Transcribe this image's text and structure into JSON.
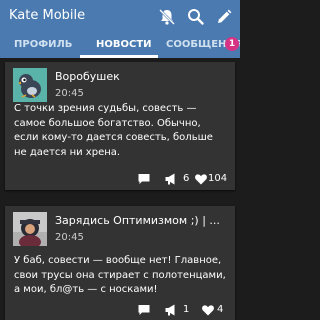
{
  "app": {
    "title": "Kate Mobile"
  },
  "actionbar": {
    "icons": [
      "notifications-off-icon",
      "search-icon",
      "edit-icon"
    ]
  },
  "tabs": [
    {
      "label": "ПРОФИЛЬ",
      "active": false
    },
    {
      "label": "НОВОСТИ",
      "active": true
    },
    {
      "label": "СООБЩЕНИЯ",
      "active": false
    }
  ],
  "messages_badge": "1",
  "posts": [
    {
      "author": "Воробушек",
      "time": "20:45",
      "text": "С точки зрения судьбы, совесть — самое большое богатство. Обычно, если кому-то дается совесть, больше не дается ни хрена.",
      "reposts": "6",
      "likes": "104"
    },
    {
      "author": "Зарядись Оптимизмом ;) | ...",
      "time": "20:45",
      "text": "У баб, совести — вообще нет! Главное, свои трусы она стирает с полотенцами, а мои, бл@ть — с носками!",
      "reposts": "1",
      "likes": "4"
    }
  ],
  "colors": {
    "header": "#4a7ab0",
    "background": "#1c1c1c",
    "card": "#333333",
    "badge": "#d63384"
  }
}
